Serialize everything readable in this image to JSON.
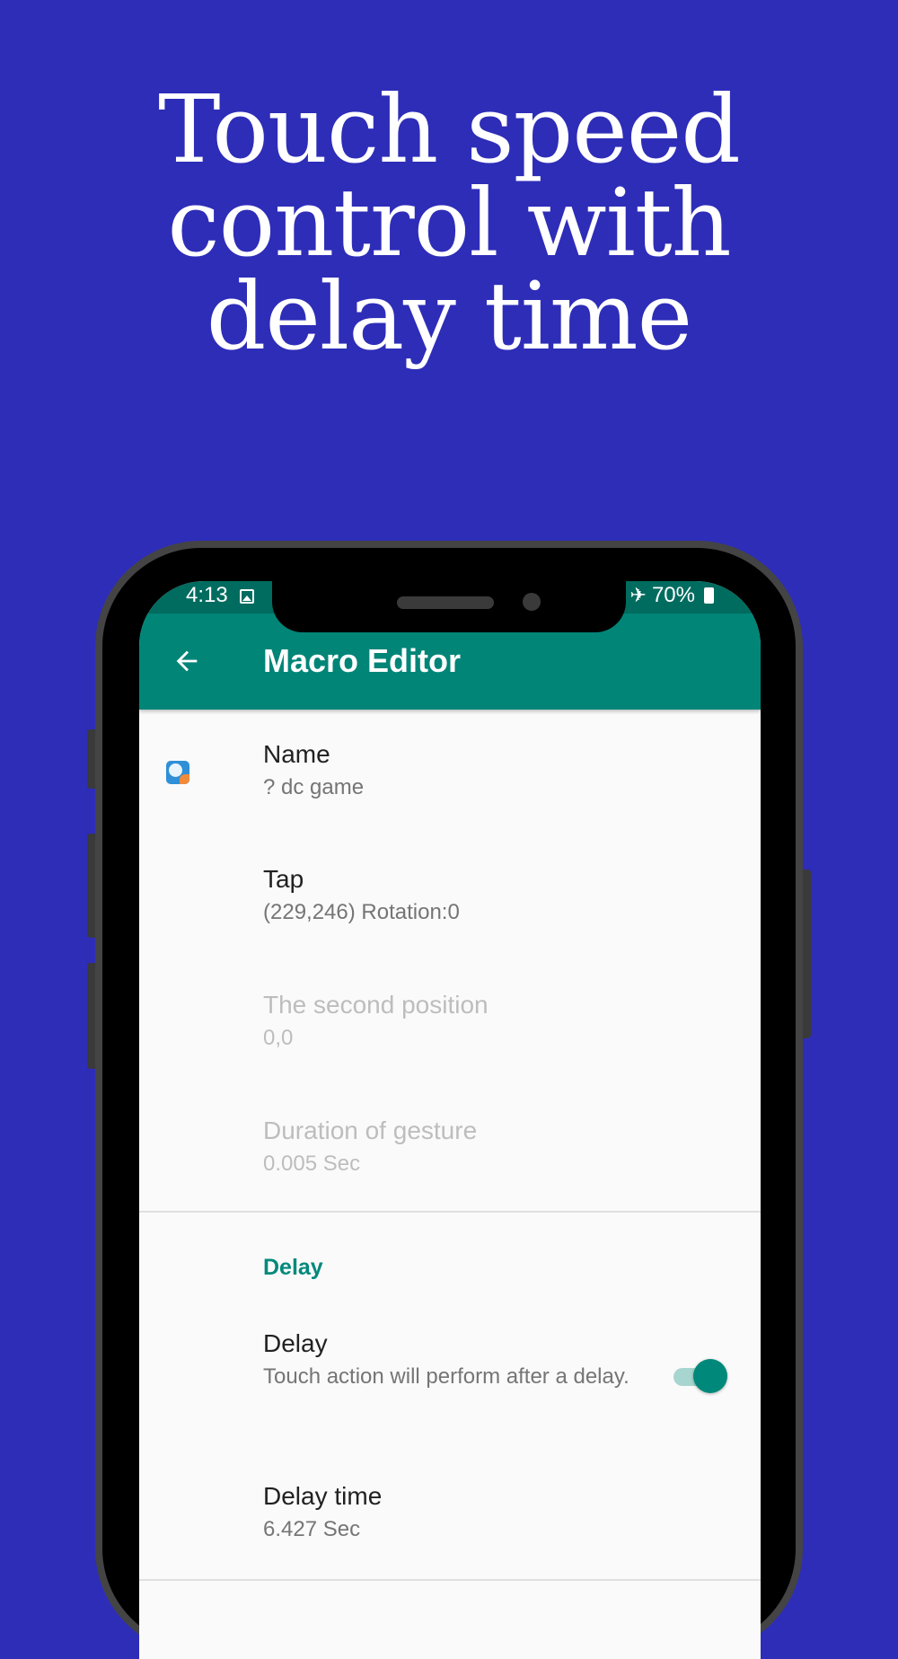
{
  "headline": {
    "line1": "Touch speed",
    "line2": "control with",
    "line3": "delay time"
  },
  "status_bar": {
    "time": "4:13",
    "battery": "70%",
    "icons": [
      "image-icon",
      "airplane-icon",
      "battery-icon"
    ]
  },
  "app_bar": {
    "title": "Macro Editor",
    "back_icon": "arrow-back-icon"
  },
  "rows": {
    "name": {
      "title": "Name",
      "value": "? dc game"
    },
    "tap": {
      "title": "Tap",
      "value": "(229,246) Rotation:0"
    },
    "second_position": {
      "title": "The second position",
      "value": "0,0"
    },
    "duration": {
      "title": "Duration of gesture",
      "value": "0.005 Sec"
    }
  },
  "delay_section": {
    "header": "Delay",
    "delay": {
      "title": "Delay",
      "summary": "Touch action will perform after a delay.",
      "enabled": true
    },
    "delay_time": {
      "title": "Delay time",
      "value": "6.427 Sec"
    }
  },
  "colors": {
    "background": "#2e2db8",
    "app_bar": "#008577",
    "status_bar": "#006c5f",
    "accent": "#00897b"
  }
}
